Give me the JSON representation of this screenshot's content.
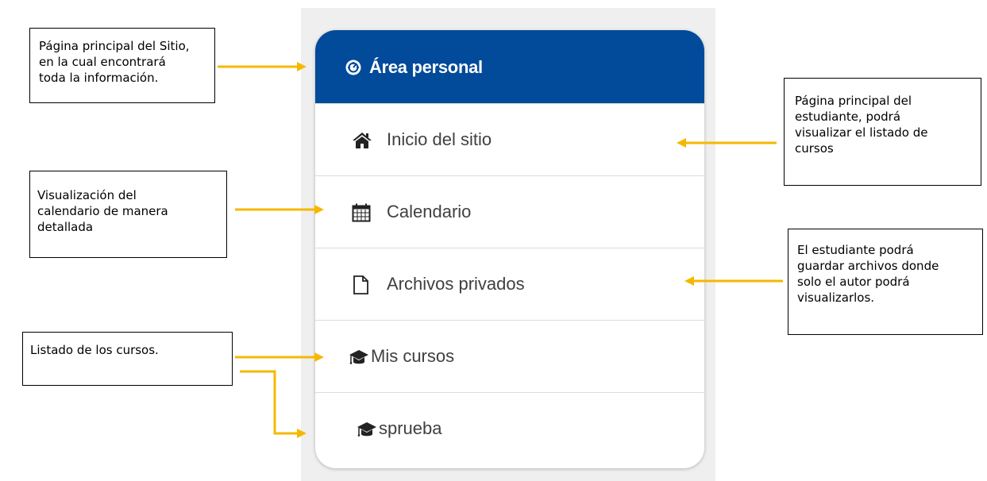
{
  "menu": {
    "header": {
      "label": "Área personal",
      "icon": "dashboard-icon"
    },
    "items": [
      {
        "label": "Inicio del sitio",
        "icon": "home-icon"
      },
      {
        "label": "Calendario",
        "icon": "calendar-icon"
      },
      {
        "label": "Archivos privados",
        "icon": "file-icon"
      },
      {
        "label": "Mis cursos",
        "icon": "graduation-cap-icon"
      },
      {
        "label": "sprueba",
        "icon": "graduation-cap-icon"
      }
    ]
  },
  "callouts": {
    "area_personal": "Página principal del Sitio,\nen la cual encontrará\ntoda la información.",
    "inicio_sitio": "Página principal del\nestudiante, podrá\nvisualizar el listado de\ncursos",
    "calendario": "Visualización del\ncalendario de manera\ndetallada",
    "archivos": "El estudiante podrá\nguardar archivos donde\nsolo el autor podrá\nvisualizarlos.",
    "cursos": "Listado de los cursos."
  },
  "colors": {
    "header_bg": "#024a9a",
    "arrow": "#f5b800",
    "panel_bg": "#efefef"
  }
}
